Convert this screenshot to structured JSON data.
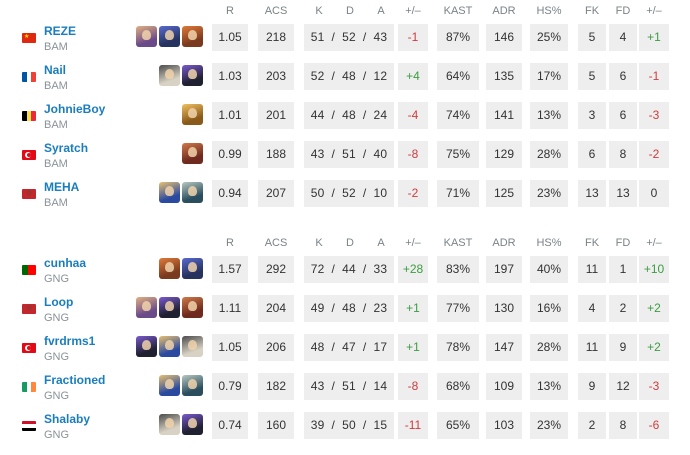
{
  "columns": {
    "r": "R",
    "acs": "ACS",
    "k": "K",
    "d": "D",
    "a": "A",
    "pm": "+/–",
    "kast": "KAST",
    "adr": "ADR",
    "hs": "HS%",
    "fk": "FK",
    "fd": "FD",
    "fkpm": "+/–"
  },
  "teams": [
    {
      "players": [
        {
          "name": "REZE",
          "team": "BAM",
          "flag": "cn",
          "agents": [
            "a-purple",
            "a-navy",
            "a-orange"
          ],
          "r": "1.05",
          "acs": "218",
          "kda": "51  /  52  /  43",
          "pm": "-1",
          "pm_sign": "neg",
          "kast": "87%",
          "adr": "146",
          "hs": "25%",
          "fk": "5",
          "fd": "4",
          "fkpm": "+1",
          "fkpm_sign": "pos"
        },
        {
          "name": "Nail",
          "team": "BAM",
          "flag": "fr",
          "agents": [
            "a-white",
            "a-dark"
          ],
          "r": "1.03",
          "acs": "203",
          "kda": "52  /  48  /  12",
          "pm": "+4",
          "pm_sign": "pos",
          "kast": "64%",
          "adr": "135",
          "hs": "17%",
          "fk": "5",
          "fd": "6",
          "fkpm": "-1",
          "fkpm_sign": "neg"
        },
        {
          "name": "JohnieBoy",
          "team": "BAM",
          "flag": "be",
          "agents": [
            "a-gold"
          ],
          "r": "1.01",
          "acs": "201",
          "kda": "44  /  48  /  24",
          "pm": "-4",
          "pm_sign": "neg",
          "kast": "74%",
          "adr": "141",
          "hs": "13%",
          "fk": "3",
          "fd": "6",
          "fkpm": "-3",
          "fkpm_sign": "neg"
        },
        {
          "name": "Syratch",
          "team": "BAM",
          "flag": "tr",
          "agents": [
            "a-red"
          ],
          "r": "0.99",
          "acs": "188",
          "kda": "43  /  51  /  40",
          "pm": "-8",
          "pm_sign": "neg",
          "kast": "75%",
          "adr": "129",
          "hs": "28%",
          "fk": "6",
          "fd": "8",
          "fkpm": "-2",
          "fkpm_sign": "neg"
        },
        {
          "name": "MEHA",
          "team": "BAM",
          "flag": "ma",
          "agents": [
            "a-blue",
            "a-teal"
          ],
          "r": "0.94",
          "acs": "207",
          "kda": "50  /  52  /  10",
          "pm": "-2",
          "pm_sign": "neg",
          "kast": "71%",
          "adr": "125",
          "hs": "23%",
          "fk": "13",
          "fd": "13",
          "fkpm": "0",
          "fkpm_sign": "zero"
        }
      ]
    },
    {
      "players": [
        {
          "name": "cunhaa",
          "team": "GNG",
          "flag": "pt",
          "agents": [
            "a-orange",
            "a-navy"
          ],
          "r": "1.57",
          "acs": "292",
          "kda": "72  /  44  /  33",
          "pm": "+28",
          "pm_sign": "pos",
          "kast": "83%",
          "adr": "197",
          "hs": "40%",
          "fk": "11",
          "fd": "1",
          "fkpm": "+10",
          "fkpm_sign": "pos"
        },
        {
          "name": "Loop",
          "team": "GNG",
          "flag": "ma",
          "agents": [
            "a-purple",
            "a-dark",
            "a-red"
          ],
          "r": "1.11",
          "acs": "204",
          "kda": "49  /  48  /  23",
          "pm": "+1",
          "pm_sign": "pos",
          "kast": "77%",
          "adr": "130",
          "hs": "16%",
          "fk": "4",
          "fd": "2",
          "fkpm": "+2",
          "fkpm_sign": "pos"
        },
        {
          "name": "fvrdrms1",
          "team": "GNG",
          "flag": "tr",
          "agents": [
            "a-dark",
            "a-blue",
            "a-white"
          ],
          "r": "1.05",
          "acs": "206",
          "kda": "48  /  47  /  17",
          "pm": "+1",
          "pm_sign": "pos",
          "kast": "78%",
          "adr": "147",
          "hs": "28%",
          "fk": "11",
          "fd": "9",
          "fkpm": "+2",
          "fkpm_sign": "pos"
        },
        {
          "name": "Fractioned",
          "team": "GNG",
          "flag": "ie",
          "agents": [
            "a-blue",
            "a-teal"
          ],
          "r": "0.79",
          "acs": "182",
          "kda": "43  /  51  /  14",
          "pm": "-8",
          "pm_sign": "neg",
          "kast": "68%",
          "adr": "109",
          "hs": "13%",
          "fk": "9",
          "fd": "12",
          "fkpm": "-3",
          "fkpm_sign": "neg"
        },
        {
          "name": "Shalaby",
          "team": "GNG",
          "flag": "eg",
          "agents": [
            "a-white",
            "a-dark"
          ],
          "r": "0.74",
          "acs": "160",
          "kda": "39  /  50  /  15",
          "pm": "-11",
          "pm_sign": "neg",
          "kast": "65%",
          "adr": "103",
          "hs": "23%",
          "fk": "2",
          "fd": "8",
          "fkpm": "-6",
          "fkpm_sign": "neg"
        }
      ]
    }
  ]
}
